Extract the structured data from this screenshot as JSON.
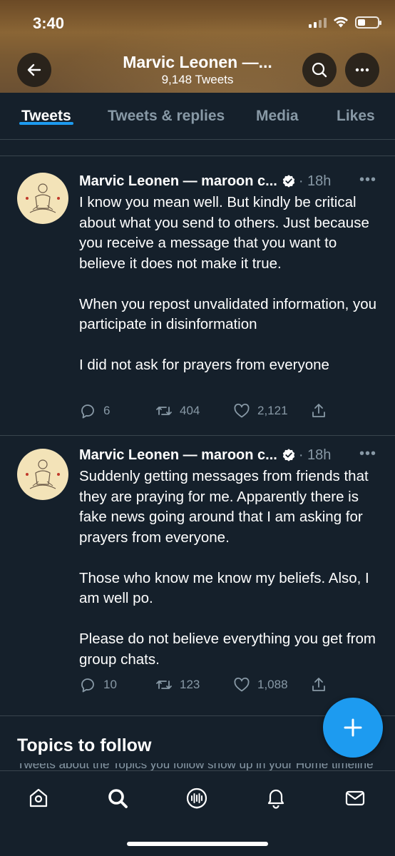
{
  "status_bar": {
    "time": "3:40"
  },
  "header": {
    "title": "Marvic Leonen —...",
    "subtitle": "9,148 Tweets"
  },
  "tabs": [
    {
      "label": "Tweets",
      "active": true
    },
    {
      "label": "Tweets & replies",
      "active": false
    },
    {
      "label": "Media",
      "active": false
    },
    {
      "label": "Likes",
      "active": false
    }
  ],
  "tweets": [
    {
      "name": "Marvic Leonen — maroon c...",
      "time": "· 18h",
      "paragraphs": [
        "I know you mean well.  But kindly be critical about what you send to others. Just because you receive a message that you want to believe it does not make it true.",
        "When you repost unvalidated information, you participate in disinformation",
        "I did not ask for prayers from everyone"
      ],
      "replies": "6",
      "retweets": "404",
      "likes": "2,121"
    },
    {
      "name": "Marvic Leonen — maroon c...",
      "time": "· 18h",
      "paragraphs": [
        "Suddenly getting messages from friends that they are praying for me. Apparently there is fake news going around that I am asking for prayers from everyone.",
        "Those who know me know my beliefs. Also, I am well po.",
        "Please do not believe everything you get from group chats."
      ],
      "replies": "10",
      "retweets": "123",
      "likes": "1,088"
    }
  ],
  "topics": {
    "title": "Topics to follow",
    "subtitle": "Tweets about the Topics you follow show up in your Home timeline"
  },
  "colors": {
    "background": "#15202b",
    "accent": "#1d9bf0",
    "muted_text": "#8899a6",
    "divider": "#38444d"
  },
  "icons": {
    "nav": [
      "home-icon",
      "search-icon",
      "spaces-icon",
      "notifications-icon",
      "messages-icon"
    ],
    "actions": [
      "reply-icon",
      "retweet-icon",
      "like-icon",
      "share-icon"
    ]
  }
}
